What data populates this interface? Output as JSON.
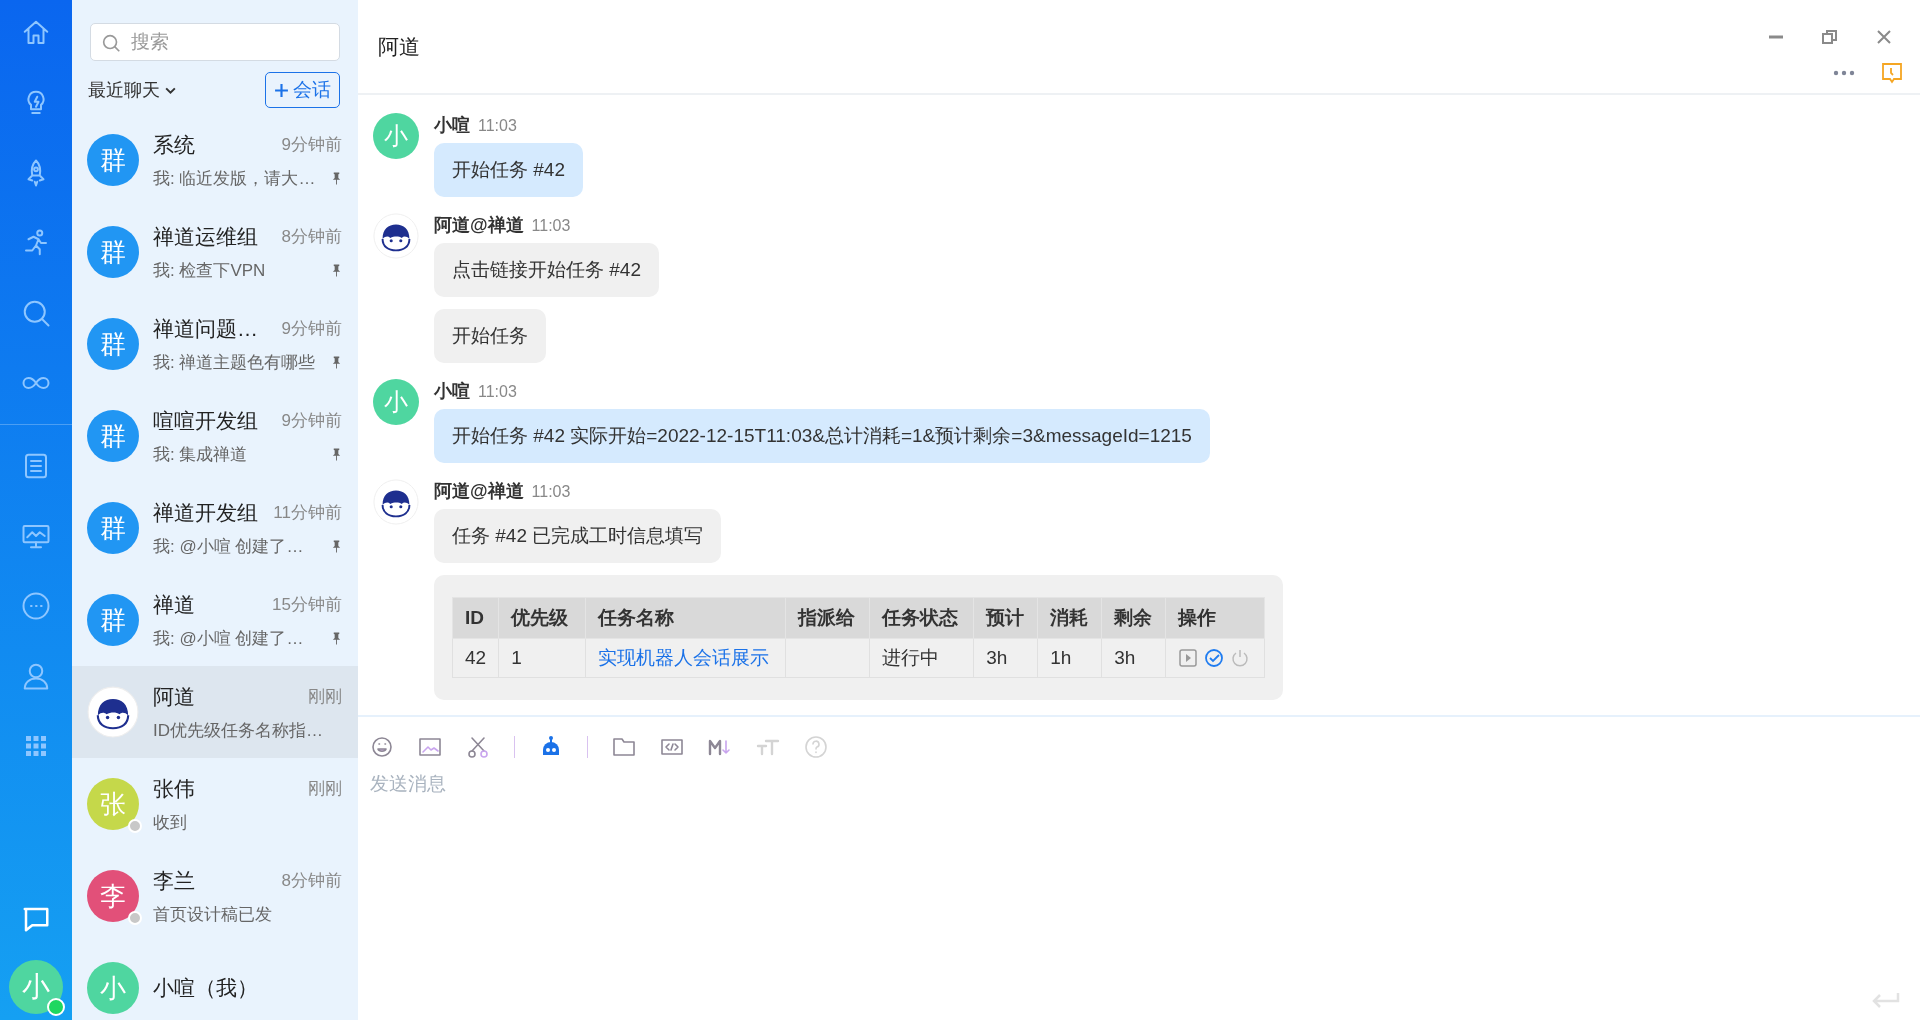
{
  "rail": {
    "user_avatar": {
      "text": "小",
      "color": "#4fd6a0",
      "online": true
    }
  },
  "sidebar": {
    "search": {
      "placeholder": "搜索"
    },
    "filter": "最近聊天",
    "new_chat_button": "会话",
    "items": [
      {
        "kind": "group",
        "avatar_text": "群",
        "color": "#2196f3",
        "name": "系统",
        "time": "9分钟前",
        "preview": "我: 临近发版，请大…",
        "pinned": true,
        "selected": false
      },
      {
        "kind": "group",
        "avatar_text": "群",
        "color": "#2196f3",
        "name": "禅道运维组",
        "time": "8分钟前",
        "preview": "我: 检查下VPN",
        "pinned": true,
        "selected": false
      },
      {
        "kind": "group",
        "avatar_text": "群",
        "color": "#2196f3",
        "name": "禅道问题…",
        "time": "9分钟前",
        "preview": "我: 禅道主题色有哪些",
        "pinned": true,
        "selected": false
      },
      {
        "kind": "group",
        "avatar_text": "群",
        "color": "#2196f3",
        "name": "喧喧开发组",
        "time": "9分钟前",
        "preview": "我: 集成禅道",
        "pinned": true,
        "selected": false
      },
      {
        "kind": "group",
        "avatar_text": "群",
        "color": "#2196f3",
        "name": "禅道开发组",
        "time": "11分钟前",
        "preview": "我: @小喧 创建了…",
        "pinned": true,
        "selected": false
      },
      {
        "kind": "group",
        "avatar_text": "群",
        "color": "#2196f3",
        "name": "禅道",
        "time": "15分钟前",
        "preview": "我: @小喧 创建了…",
        "pinned": true,
        "selected": false
      },
      {
        "kind": "robot",
        "name": "阿道",
        "time": "刚刚",
        "preview": "ID优先级任务名称指…",
        "pinned": false,
        "selected": true
      },
      {
        "kind": "person",
        "avatar_text": "张",
        "color": "#c5d84a",
        "online": false,
        "name": "张伟",
        "time": "刚刚",
        "preview": "收到",
        "pinned": false,
        "selected": false
      },
      {
        "kind": "person",
        "avatar_text": "李",
        "color": "#e25079",
        "online": false,
        "name": "李兰",
        "time": "8分钟前",
        "preview": "首页设计稿已发",
        "pinned": false,
        "selected": false
      },
      {
        "kind": "person",
        "avatar_text": "小",
        "color": "#4fd6a0",
        "name": "小喧（我）",
        "pinned": false,
        "selected": false
      }
    ]
  },
  "chat": {
    "title": "阿道",
    "messages": [
      {
        "kind": "person",
        "avatar_text": "小",
        "color": "#4fd6a0",
        "sender": "小喧",
        "time": "11:03",
        "mine": true,
        "bubbles": [
          {
            "kind": "text",
            "text": "开始任务 #42"
          }
        ]
      },
      {
        "kind": "robot",
        "sender": "阿道@禅道",
        "time": "11:03",
        "mine": false,
        "bubbles": [
          {
            "kind": "text",
            "text": "点击链接开始任务 #42"
          },
          {
            "kind": "text",
            "text": "开始任务"
          }
        ]
      },
      {
        "kind": "person",
        "avatar_text": "小",
        "color": "#4fd6a0",
        "sender": "小喧",
        "time": "11:03",
        "mine": true,
        "bubbles": [
          {
            "kind": "text",
            "text": "开始任务 #42 实际开始=2022-12-15T11:03&总计消耗=1&预计剩余=3&messageId=1215"
          }
        ]
      },
      {
        "kind": "robot",
        "sender": "阿道@禅道",
        "time": "11:03",
        "mine": false,
        "bubbles": [
          {
            "kind": "text",
            "text": "任务 #42 已完成工时信息填写"
          },
          {
            "kind": "table",
            "columns": [
              {
                "label": "ID",
                "kind": "text"
              },
              {
                "label": "优先级",
                "kind": "text"
              },
              {
                "label": "任务名称",
                "kind": "link"
              },
              {
                "label": "指派给",
                "kind": "text"
              },
              {
                "label": "任务状态",
                "kind": "text"
              },
              {
                "label": "预计",
                "kind": "text"
              },
              {
                "label": "消耗",
                "kind": "text"
              },
              {
                "label": "剩余",
                "kind": "text"
              },
              {
                "label": "操作",
                "kind": "actions"
              }
            ],
            "rows": [
              [
                "42",
                "1",
                "实现机器人会话展示",
                "",
                "进行中",
                "3h",
                "1h",
                "3h",
                ""
              ]
            ]
          }
        ]
      }
    ],
    "composer": {
      "placeholder": "发送消息"
    }
  }
}
